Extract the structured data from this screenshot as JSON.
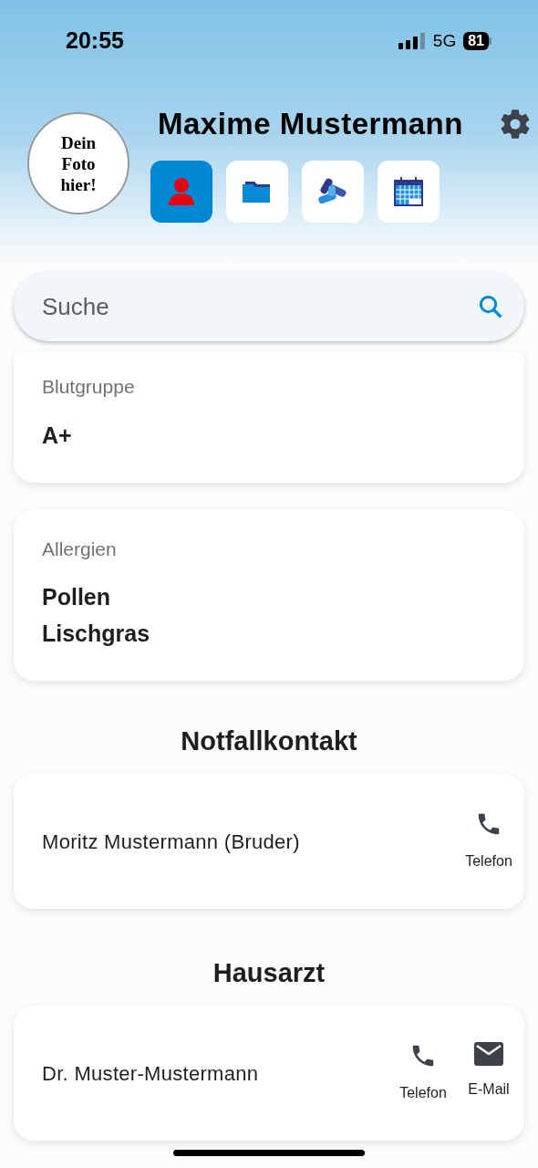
{
  "status_bar": {
    "time": "20:55",
    "network": "5G",
    "battery": "81"
  },
  "header": {
    "photo_text": "Dein Foto hier!",
    "name": "Maxime Mustermann"
  },
  "tabs": [
    {
      "kind": "person",
      "selected": true
    },
    {
      "kind": "folder",
      "selected": false
    },
    {
      "kind": "pills",
      "selected": false
    },
    {
      "kind": "calendar",
      "selected": false
    }
  ],
  "search": {
    "placeholder": "Suche"
  },
  "info_cards": [
    {
      "label": "Blutgruppe",
      "values": [
        "A+"
      ]
    },
    {
      "label": "Allergien",
      "values": [
        "Pollen",
        "Lischgras"
      ]
    }
  ],
  "sections": [
    {
      "title": "Notfallkontakt",
      "name": "Moritz Mustermann (Bruder)",
      "actions": [
        {
          "kind": "phone",
          "label": "Telefon"
        }
      ]
    },
    {
      "title": "Hausarzt",
      "name": "Dr. Muster-Mustermann",
      "actions": [
        {
          "kind": "phone",
          "label": "Telefon"
        },
        {
          "kind": "email",
          "label": "E-Mail"
        }
      ]
    }
  ]
}
